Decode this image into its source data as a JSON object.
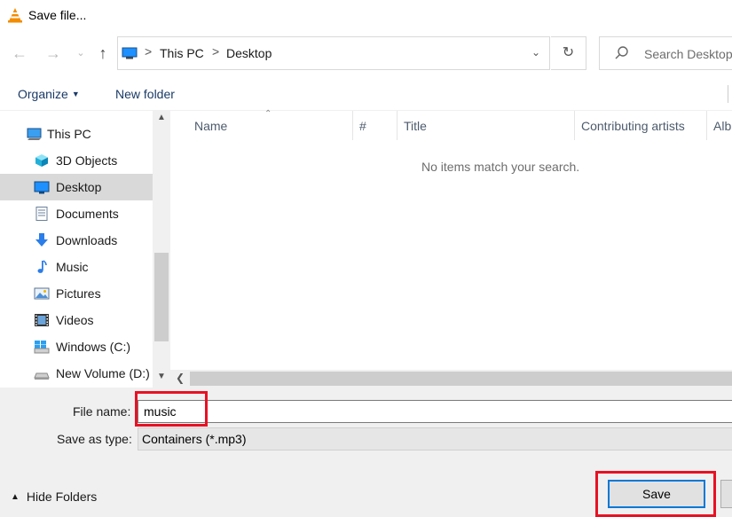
{
  "window": {
    "title": "Save file..."
  },
  "address": {
    "crumbs": [
      "This PC",
      "Desktop"
    ],
    "separator": ">"
  },
  "search": {
    "placeholder": "Search Desktop"
  },
  "toolbar": {
    "organize": "Organize",
    "new_folder": "New folder"
  },
  "sidebar": {
    "items": [
      {
        "label": "This PC",
        "icon": "computer-icon"
      },
      {
        "label": "3D Objects",
        "icon": "cube-icon"
      },
      {
        "label": "Desktop",
        "icon": "desktop-icon",
        "selected": true
      },
      {
        "label": "Documents",
        "icon": "document-icon"
      },
      {
        "label": "Downloads",
        "icon": "download-arrow-icon"
      },
      {
        "label": "Music",
        "icon": "music-note-icon"
      },
      {
        "label": "Pictures",
        "icon": "picture-icon"
      },
      {
        "label": "Videos",
        "icon": "film-icon"
      },
      {
        "label": "Windows (C:)",
        "icon": "windows-drive-icon"
      },
      {
        "label": "New Volume (D:)",
        "icon": "drive-icon"
      }
    ]
  },
  "file_list": {
    "columns": [
      "Name",
      "#",
      "Title",
      "Contributing artists",
      "Alb"
    ],
    "empty_message": "No items match your search."
  },
  "form": {
    "file_name_label": "File name:",
    "file_name_value": "music",
    "save_type_label": "Save as type:",
    "save_type_value": "Containers (*.mp3)"
  },
  "footer": {
    "hide_folders": "Hide Folders",
    "save_button": "Save"
  },
  "colors": {
    "accent": "#0078d7",
    "highlight_box": "#e81123",
    "selected_row": "#d9d9d9"
  }
}
